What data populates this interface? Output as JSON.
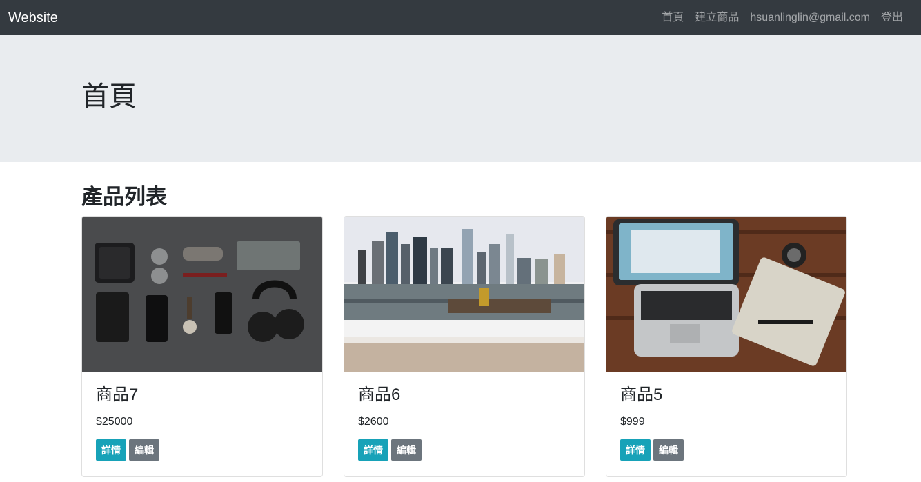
{
  "navbar": {
    "brand": "Website",
    "links": [
      "首頁",
      "建立商品",
      "hsuanlinglin@gmail.com",
      "登出"
    ]
  },
  "jumbotron": {
    "title": "首頁"
  },
  "section": {
    "title": "產品列表"
  },
  "products": [
    {
      "name": "商品7",
      "price": "$25000",
      "detail_label": "詳情",
      "edit_label": "編輯",
      "image": "flatlay-accessories-photo"
    },
    {
      "name": "商品6",
      "price": "$2600",
      "detail_label": "詳情",
      "edit_label": "編輯",
      "image": "city-skyline-bench-photo"
    },
    {
      "name": "商品5",
      "price": "$999",
      "detail_label": "詳情",
      "edit_label": "編輯",
      "image": "laptop-desk-photo"
    }
  ],
  "colors": {
    "navbar_bg": "#343a40",
    "jumbotron_bg": "#e9ecef",
    "btn_info": "#17a2b8",
    "btn_secondary": "#6c757d"
  }
}
